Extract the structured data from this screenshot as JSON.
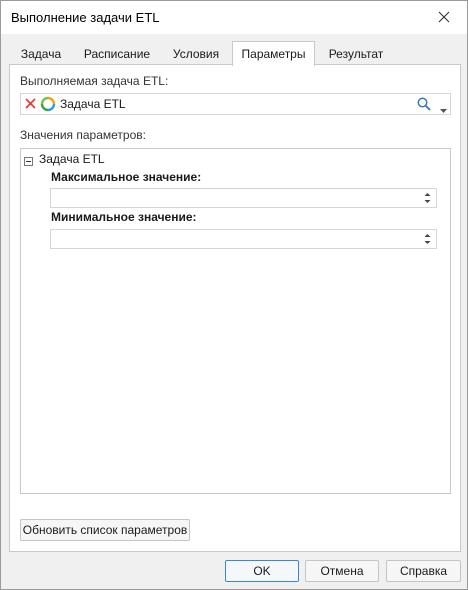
{
  "window": {
    "title": "Выполнение задачи ETL"
  },
  "tabs": [
    {
      "label": "Задача",
      "active": false
    },
    {
      "label": "Расписание",
      "active": false
    },
    {
      "label": "Условия",
      "active": false
    },
    {
      "label": "Параметры",
      "active": true
    },
    {
      "label": "Результат",
      "active": false
    }
  ],
  "etl_task": {
    "label": "Выполняемая задача ETL:",
    "value": "Задача ETL",
    "icons": [
      "clear-icon",
      "etl-task-icon",
      "search-icon",
      "dropdown-arrow-icon"
    ]
  },
  "parameters": {
    "label": "Значения параметров:",
    "tree_root": "Задача ETL",
    "tree_toggle": "collapse-minus-icon",
    "max_label": "Максимальное значение:",
    "max_value": "",
    "min_label": "Минимальное значение:",
    "min_value": ""
  },
  "refresh_button": "Обновить список параметров",
  "footer": {
    "ok": "OK",
    "cancel": "Отмена",
    "help": "Справка"
  },
  "colors": {
    "accent": "#3a86d6",
    "clear_red": "#e53935",
    "tab_active_bg": "#ffffff"
  }
}
